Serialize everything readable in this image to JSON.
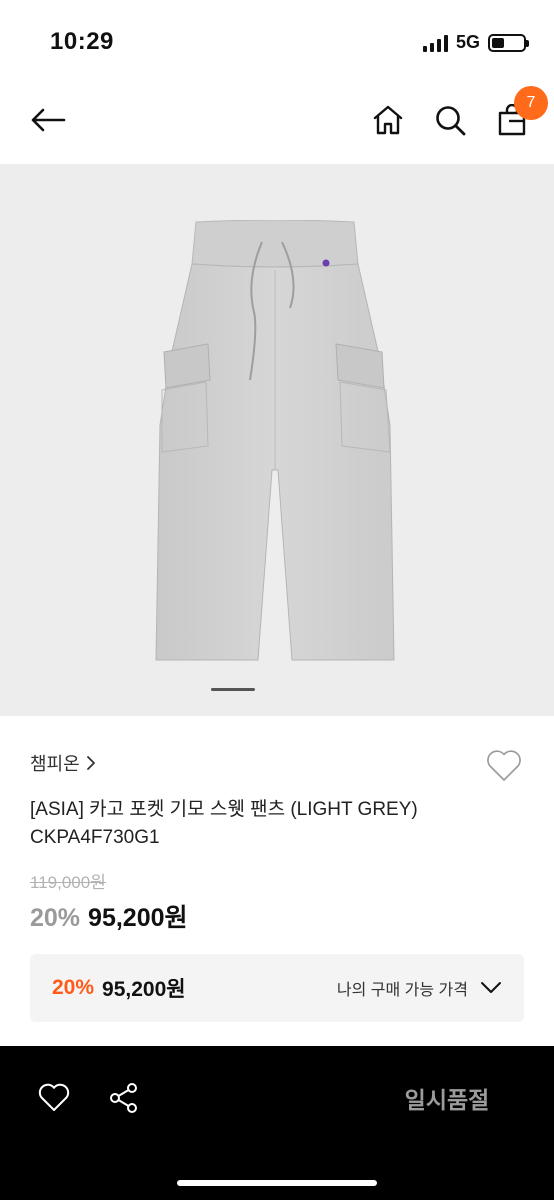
{
  "status": {
    "time": "10:29",
    "network": "5G"
  },
  "nav": {
    "cart_count": "7"
  },
  "product": {
    "brand": "챔피온",
    "brand_chevron": "›",
    "title_line1": "[ASIA] 카고 포켓 기모 스웻 팬츠 (LIGHT GREY)",
    "title_line2": "CKPA4F730G1",
    "original_price": "119,000원",
    "discount_rate": "20%",
    "sale_price": "95,200원"
  },
  "member_price": {
    "discount_rate": "20%",
    "price": "95,200원",
    "label": "나의 구매 가능 가격"
  },
  "bottom_bar": {
    "status_label": "일시품절"
  },
  "colors": {
    "accent": "#ff6b1a",
    "discount_orange": "#ff5a1a",
    "image_bg": "#ededed"
  },
  "icons": [
    "back-arrow-icon",
    "home-icon",
    "search-icon",
    "shopping-bag-icon",
    "heart-icon",
    "share-icon",
    "chevron-down-icon"
  ]
}
